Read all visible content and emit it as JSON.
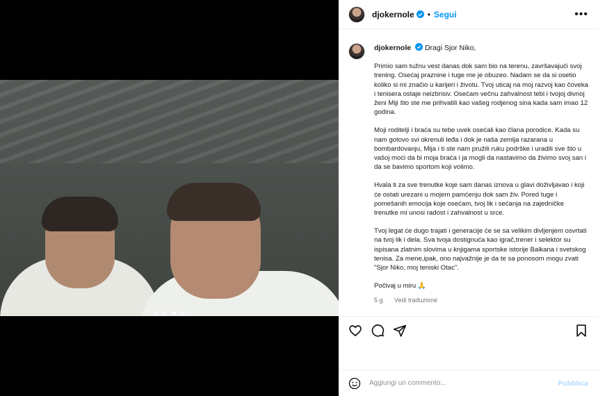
{
  "post": {
    "username": "djokernole",
    "separator": "•",
    "follow_label": "Segui",
    "more_label": "•••"
  },
  "carousel": {
    "slides": 4,
    "active": 3
  },
  "caption": {
    "username": "djokernole",
    "greeting": "Dragi Sjor Niko,",
    "paragraphs": [
      "Primio sam tužnu vest danas dok sam bio na terenu, završavajući svoj trening. Osećaj praznine i tuge me je obuzeo. Nadam se da si osetio koliko si mi značio u karijeri i životu. Tvoj uticaj na moj razvoj kao čoveka i tenisera ostaje neizbrisiv. Osećam večnu zahvalnost tebi i tvojoj divnoj ženi Miji što ste me prihvatili kao vašeg rodjenog sina kada sam imao 12 godina.",
      "Moji roditelji i braća su tebe uvek osećali kao člana porodice. Kada su nam gotovo svi okrenuli leđa i dok je naša zemlja razarana u bombardovanju, Mija i ti ste nam pružili ruku podrške i uradili sve što u vašoj moći da bi moja braća i ja mogli da nastavimo da živimo svoj san i da se bavimo sportom koji volimo.",
      "Hvala ti za sve trenutke koje sam danas iznova u glavi doživljavao i koji će ostati urezani u mojem pamćenju dok sam živ. Pored tuge i pomešanih emocija koje osećam, tvoj lik i sećanja na zajedničke trenutke mi unosi radost i zahvalnost u srce.",
      "Tvoj legat će dugo trajati i generacije će se sa velikim divljenjem osvrtati na tvoj lik i dela. Sva tvoja dostignuća kao igrač,trener i selektor su ispisana zlatnim slovima u knjigama sportske istorije Balkana i svetskog tenisa. Za mene,ipak, ono najvažnije je da te sa ponosom mogu zvati \"Sjor Niko, moj teniski Otac\".",
      "Počivaj u miru 🙏"
    ],
    "time": "5 g",
    "translate_label": "Vedi traduzione"
  },
  "actions": {
    "like": "heart-icon",
    "comment": "comment-icon",
    "share": "share-icon",
    "save": "bookmark-icon"
  },
  "comment_box": {
    "placeholder": "Aggiungi un commento...",
    "publish_label": "Pubblica"
  },
  "colors": {
    "accent": "#0095f6",
    "publish_disabled": "#b3dbff",
    "muted": "#737373"
  }
}
